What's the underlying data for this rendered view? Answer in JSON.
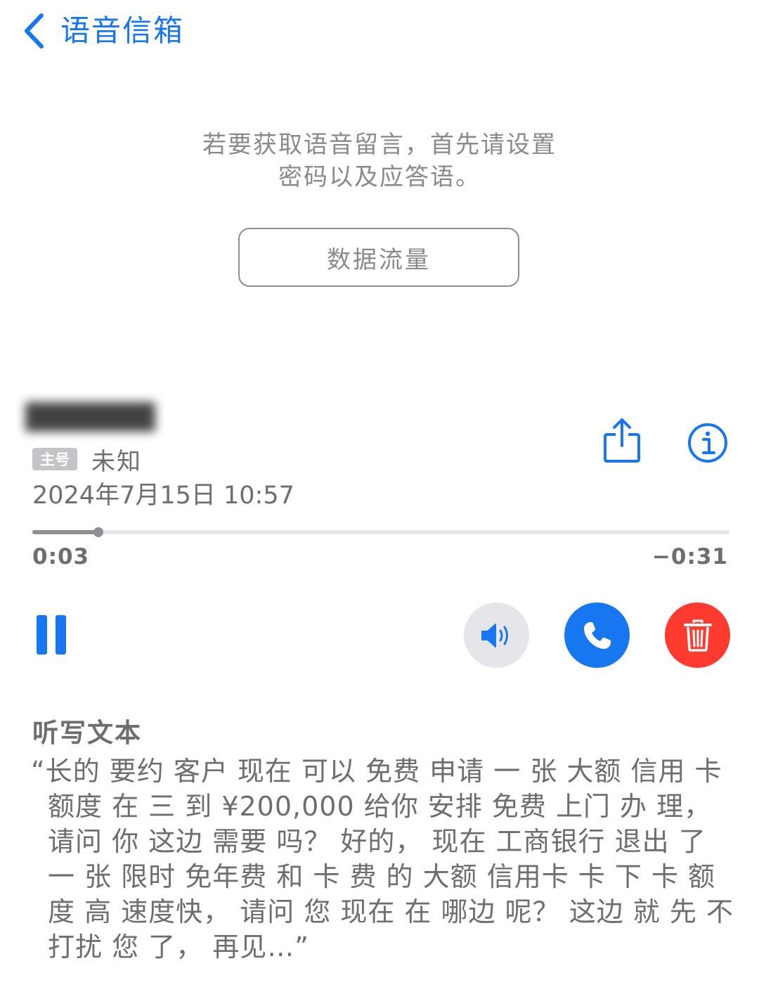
{
  "nav": {
    "back_label": "语音信箱"
  },
  "info": {
    "line1": "若要获取语音留言，首先请设置",
    "line2": "密码以及应答语。"
  },
  "data_button_label": "数据流量",
  "voicemail": {
    "caller": "██████",
    "line_badge": "主号",
    "caller_type": "未知",
    "date": "2024年7月15日 10:57",
    "elapsed": "0:03",
    "remaining": "−0:31",
    "progress_fraction": 0.095
  },
  "transcript": {
    "title": "听写文本",
    "text": "“长的 要约 客户 现在 可以 免费 申请 一 张 大额 信用 卡 额度 在 三 到 ¥200,000 给你 安排 免费 上门 办 理， 请问 你 这边 需要 吗？ 好的， 现在 工商银行 退出 了 一 张 限时 免年费 和 卡 费 的 大额 信用卡 卡 下 卡 额度 高 速度快， 请问 您 现在 在 哪边 呢？ 这边 就 先 不 打扰 您 了， 再见…”"
  },
  "icons": {
    "back": "chevron-left-icon",
    "share": "share-icon",
    "info": "info-icon",
    "pause": "pause-icon",
    "speaker": "speaker-icon",
    "call": "phone-icon",
    "delete": "trash-icon"
  },
  "colors": {
    "accent": "#1677F0",
    "delete": "#FF3B30",
    "secondary_text": "#6d6d72",
    "speaker_bg": "#e5e5ea"
  }
}
